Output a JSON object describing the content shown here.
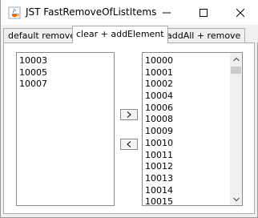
{
  "window": {
    "title": "JST FastRemoveOfListItems"
  },
  "icons": {
    "app": "java-cup-icon",
    "minimize": "minimize-icon",
    "maximize": "maximize-icon",
    "close": "close-icon",
    "move_right": "arrow-right-icon",
    "move_left": "arrow-left-icon",
    "scroll_up": "chevron-up-icon",
    "scroll_down": "chevron-down-icon"
  },
  "tabs": [
    {
      "label": "default remove",
      "selected": false
    },
    {
      "label": "clear + addElement",
      "selected": true
    },
    {
      "label": "addAll + remove",
      "selected": false
    }
  ],
  "left_list": {
    "items": [
      "10003",
      "10005",
      "10007"
    ]
  },
  "right_list": {
    "items": [
      "10000",
      "10001",
      "10002",
      "10004",
      "10006",
      "10008",
      "10009",
      "10010",
      "10011",
      "10012",
      "10013",
      "10014",
      "10015"
    ]
  },
  "buttons": {
    "move_right_label": ">",
    "move_left_label": "<"
  },
  "colors": {
    "window_bg": "#f0f0f0",
    "panel_bg": "#ffffff",
    "border": "#8a8a8a",
    "scroll_thumb": "#cdcdcd"
  }
}
